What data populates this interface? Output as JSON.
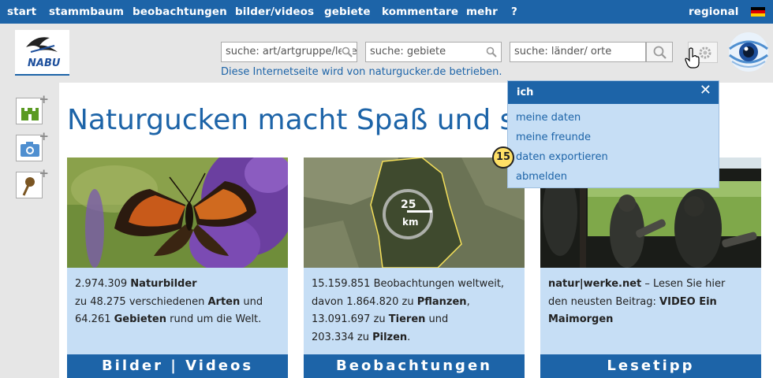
{
  "nav": {
    "items": [
      "start",
      "stammbaum",
      "beobachtungen",
      "bilder/videos",
      "gebiete",
      "kommentare",
      "mehr",
      "?"
    ],
    "regional": "regional"
  },
  "logo": {
    "text": "NABU"
  },
  "search": {
    "art_placeholder": "suche: art/artgruppe/leben",
    "gebiete_placeholder": "suche: gebiete",
    "orte_placeholder": "suche: länder/ orte"
  },
  "operator_note": "Diese Internetseite wird von naturgucker.de betrieben.",
  "headline": "Naturgucken macht Spaß und s",
  "cards": [
    {
      "lines": [
        [
          "2.974.309 ",
          "Naturbilder",
          ""
        ],
        [
          "zu 48.275 verschiedenen ",
          "Arten",
          " und"
        ],
        [
          "64.261 ",
          "Gebieten",
          " rund um die Welt."
        ]
      ],
      "footer": "Bilder | Videos"
    },
    {
      "map_label": "25",
      "map_unit": "km",
      "lines": [
        [
          "15.159.851 Beobachtungen weltweit,",
          "",
          ""
        ],
        [
          "davon 1.864.820 zu ",
          "Pflanzen",
          ","
        ],
        [
          "13.091.697 zu ",
          "Tieren",
          " und"
        ],
        [
          "203.334 zu ",
          "Pilzen",
          "."
        ]
      ],
      "footer": "Beobachtungen"
    },
    {
      "lines": [
        [
          "",
          "natur|werke.net",
          " – Lesen Sie hier"
        ],
        [
          "den neusten Beitrag: ",
          "VIDEO Ein",
          ""
        ],
        [
          "",
          "Maimorgen",
          ""
        ]
      ],
      "footer": "Lesetipp"
    }
  ],
  "dropdown": {
    "title": "ich",
    "close": "✕",
    "items": [
      "meine daten",
      "meine freunde",
      "daten exportieren",
      "abmelden"
    ]
  },
  "badge": "15",
  "colors": {
    "primary": "#1d64a8",
    "card_bg": "#c6def5",
    "badge": "#ffe066"
  }
}
